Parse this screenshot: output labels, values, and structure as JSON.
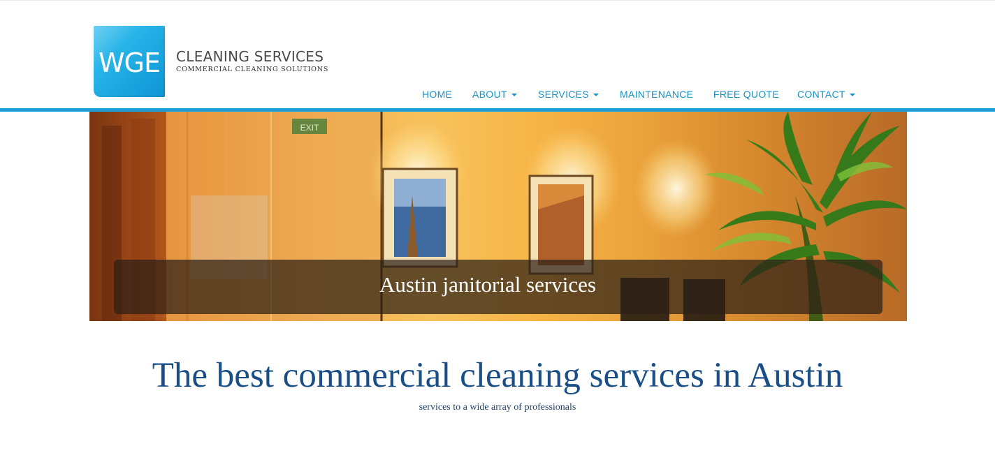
{
  "logo": {
    "mark": "WGE",
    "title": "CLEANING SERVICES",
    "subtitle": "COMMERCIAL CLEANING SOLUTIONS"
  },
  "nav": {
    "items": [
      {
        "label": "HOME",
        "dropdown": false
      },
      {
        "label": "ABOUT",
        "dropdown": true
      },
      {
        "label": "SERVICES",
        "dropdown": true
      },
      {
        "label": "MAINTENANCE",
        "dropdown": false
      },
      {
        "label": "FREE QUOTE",
        "dropdown": false
      },
      {
        "label": "CONTACT",
        "dropdown": true
      }
    ]
  },
  "hero": {
    "caption": "Austin janitorial services",
    "exit_sign": "EXIT"
  },
  "main": {
    "headline": "The best commercial cleaning services in Austin",
    "subline": "services to a wide array of professionals"
  },
  "colors": {
    "accent": "#1aa0d8",
    "nav_text": "#1993c4",
    "headline": "#1a4e86"
  }
}
